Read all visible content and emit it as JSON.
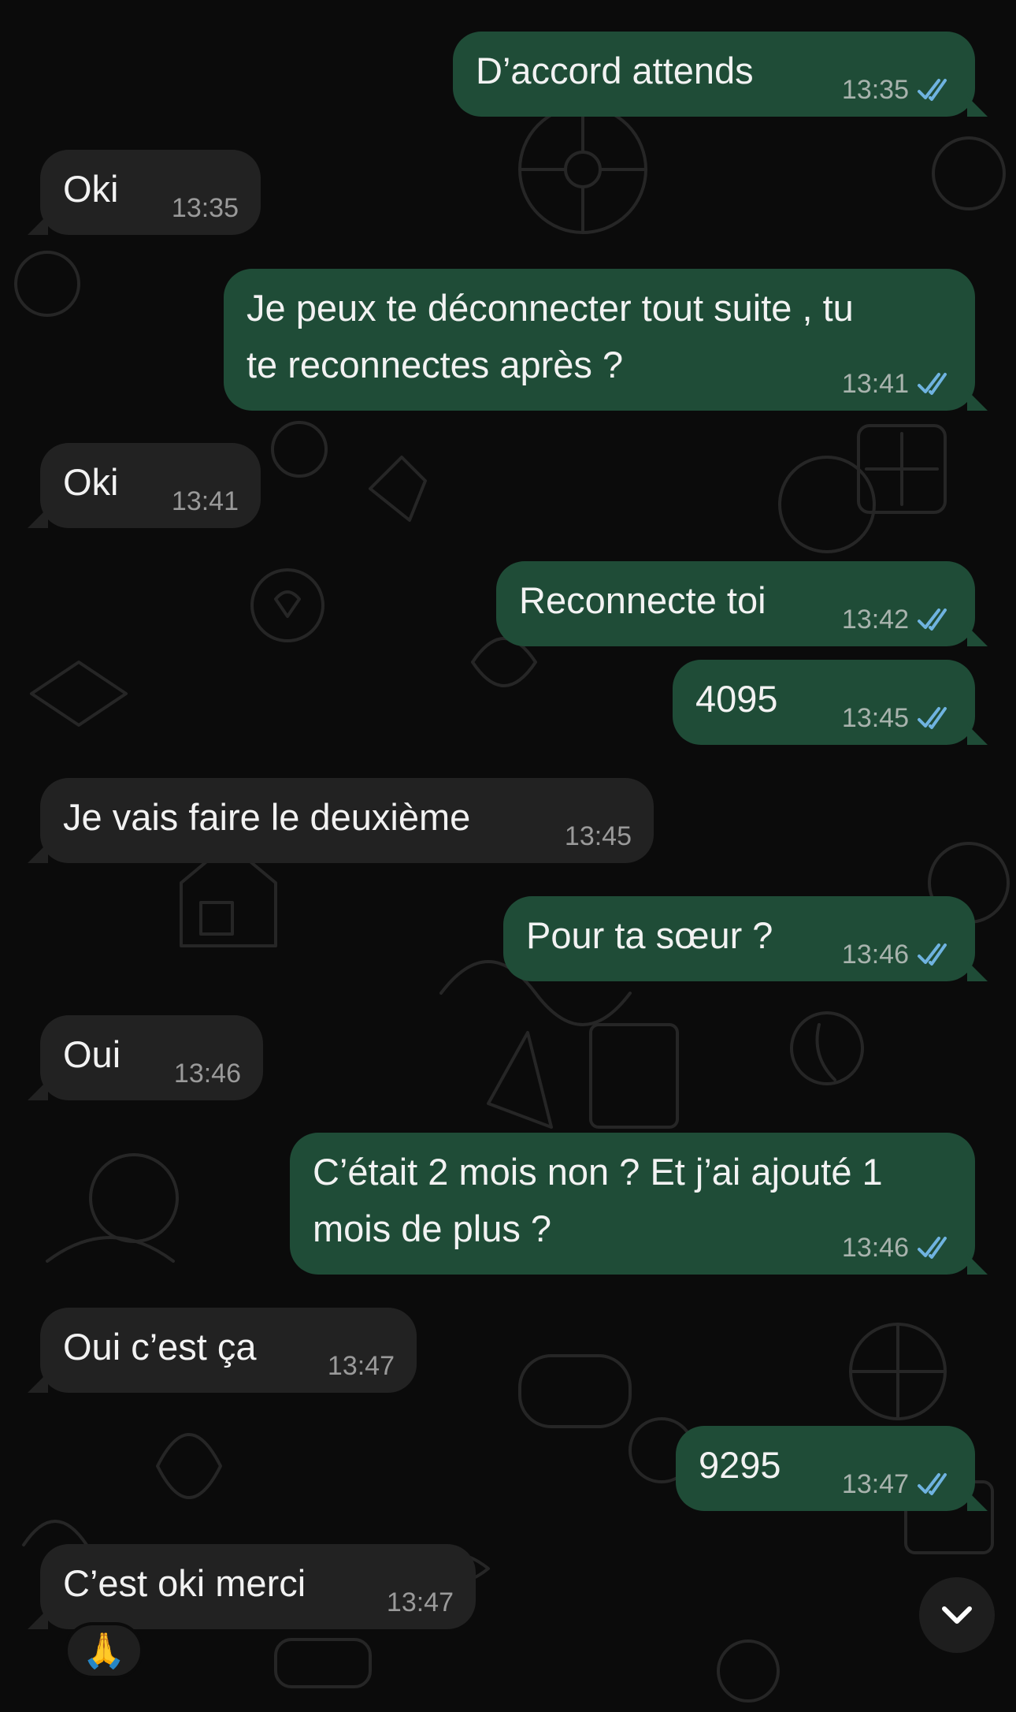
{
  "colors": {
    "outgoing_bubble": "#1f4c37",
    "incoming_bubble": "#222222",
    "background": "#0b0b0b",
    "read_ticks": "#6fb3e0"
  },
  "messages": [
    {
      "dir": "out",
      "lines": [
        "D’accord attends"
      ],
      "time": "13:35",
      "read": true
    },
    {
      "dir": "in",
      "lines": [
        "Oki"
      ],
      "time": "13:35"
    },
    {
      "dir": "out",
      "lines": [
        "Je peux te déconnecter tout suite , tu",
        "te reconnectes après ?"
      ],
      "time": "13:41",
      "read": true
    },
    {
      "dir": "in",
      "lines": [
        "Oki"
      ],
      "time": "13:41"
    },
    {
      "dir": "out",
      "lines": [
        "Reconnecte toi"
      ],
      "time": "13:42",
      "read": true
    },
    {
      "dir": "out",
      "lines": [
        "4095"
      ],
      "time": "13:45",
      "read": true
    },
    {
      "dir": "in",
      "lines": [
        "Je vais faire le deuxième"
      ],
      "time": "13:45"
    },
    {
      "dir": "out",
      "lines": [
        "Pour ta sœur ?"
      ],
      "time": "13:46",
      "read": true
    },
    {
      "dir": "in",
      "lines": [
        "Oui"
      ],
      "time": "13:46"
    },
    {
      "dir": "out",
      "lines": [
        "C’était 2 mois non ? Et j’ai ajouté 1",
        "mois de plus ?"
      ],
      "time": "13:46",
      "read": true
    },
    {
      "dir": "in",
      "lines": [
        "Oui c’est ça"
      ],
      "time": "13:47"
    },
    {
      "dir": "out",
      "lines": [
        "9295"
      ],
      "time": "13:47",
      "read": true
    },
    {
      "dir": "in",
      "lines": [
        "C’est oki merci"
      ],
      "time": "13:47",
      "reaction": "🙏"
    }
  ],
  "scroll_button": {
    "icon": "chevron-down-icon"
  }
}
